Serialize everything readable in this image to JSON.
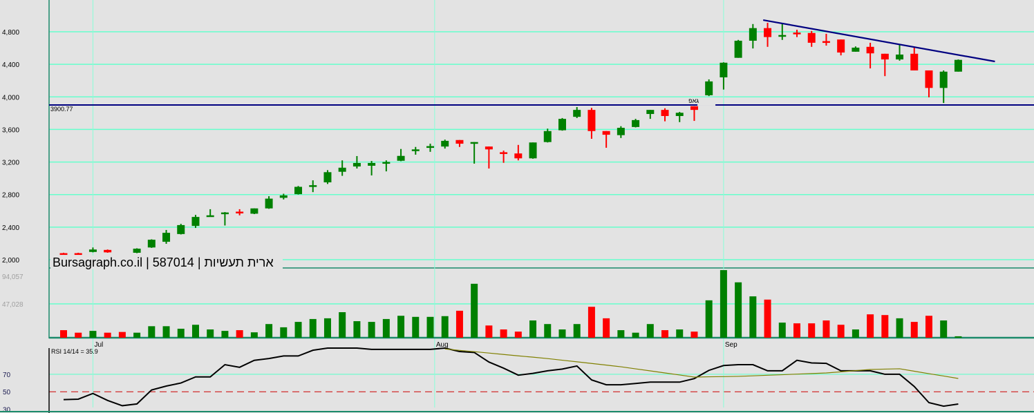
{
  "chart_data": {
    "type": "candlestick",
    "title": "Bursagraph.co.il | 587014 | ארית תעשיות",
    "colors": {
      "up": "#008000",
      "down": "#ff0000",
      "grid": "#66ffcc",
      "trendline": "#000080",
      "rsi": "#000000",
      "rsi_ma": "#808000",
      "background": "#e3e3e3"
    },
    "x_labels": [
      {
        "label": "Jul",
        "index": 2
      },
      {
        "label": "Aug",
        "index": 25.3
      },
      {
        "label": "Sep",
        "index": 45
      }
    ],
    "price_axis": {
      "ticks": [
        2000,
        2400,
        2800,
        3200,
        3600,
        4000,
        4400,
        4800
      ],
      "tick_labels": [
        "2,000",
        "2,400",
        "2,800",
        "3,200",
        "3,600",
        "4,000",
        "4,400",
        "4,800"
      ]
    },
    "candles": [
      [
        2080,
        2085,
        2065,
        2070
      ],
      [
        2080,
        2085,
        2065,
        2070
      ],
      [
        2095,
        2150,
        2090,
        2125
      ],
      [
        2120,
        2125,
        2085,
        2090
      ],
      [
        2010,
        2015,
        1985,
        1990
      ],
      [
        2085,
        2140,
        2080,
        2135
      ],
      [
        2150,
        2250,
        2145,
        2245
      ],
      [
        2220,
        2365,
        2195,
        2330
      ],
      [
        2315,
        2440,
        2310,
        2425
      ],
      [
        2415,
        2550,
        2390,
        2525
      ],
      [
        2535,
        2620,
        2530,
        2545
      ],
      [
        2570,
        2585,
        2420,
        2580
      ],
      [
        2590,
        2620,
        2545,
        2580
      ],
      [
        2565,
        2630,
        2560,
        2630
      ],
      [
        2630,
        2780,
        2625,
        2750
      ],
      [
        2760,
        2810,
        2740,
        2790
      ],
      [
        2805,
        2905,
        2800,
        2895
      ],
      [
        2905,
        2975,
        2830,
        2915
      ],
      [
        2950,
        3100,
        2930,
        3075
      ],
      [
        3080,
        3220,
        3030,
        3130
      ],
      [
        3145,
        3273,
        3120,
        3188
      ],
      [
        3154,
        3213,
        3035,
        3188
      ],
      [
        3195,
        3220,
        3085,
        3200
      ],
      [
        3215,
        3360,
        3210,
        3275
      ],
      [
        3345,
        3385,
        3290,
        3355
      ],
      [
        3390,
        3425,
        3325,
        3395
      ],
      [
        3390,
        3475,
        3365,
        3460
      ],
      [
        3470,
        3470,
        3385,
        3425
      ],
      [
        3440,
        3445,
        3180,
        3445
      ],
      [
        3390,
        3390,
        3120,
        3355
      ],
      [
        3320,
        3340,
        3190,
        3315
      ],
      [
        3305,
        3410,
        3220,
        3245
      ],
      [
        3245,
        3440,
        3240,
        3440
      ],
      [
        3445,
        3610,
        3440,
        3580
      ],
      [
        3590,
        3740,
        3585,
        3730
      ],
      [
        3755,
        3875,
        3740,
        3840
      ],
      [
        3840,
        3865,
        3485,
        3580
      ],
      [
        3580,
        3580,
        3375,
        3535
      ],
      [
        3530,
        3640,
        3495,
        3620
      ],
      [
        3630,
        3730,
        3625,
        3715
      ],
      [
        3790,
        3840,
        3730,
        3840
      ],
      [
        3840,
        3860,
        3700,
        3765
      ],
      [
        3765,
        3815,
        3690,
        3805
      ],
      [
        3885,
        3885,
        3705,
        3840
      ],
      [
        4020,
        4215,
        4010,
        4190
      ],
      [
        4240,
        4425,
        4090,
        4420
      ],
      [
        4480,
        4700,
        4480,
        4690
      ],
      [
        4690,
        4895,
        4595,
        4845
      ],
      [
        4845,
        4910,
        4615,
        4735
      ],
      [
        4755,
        4895,
        4700,
        4760
      ],
      [
        4790,
        4825,
        4735,
        4780
      ],
      [
        4785,
        4810,
        4615,
        4665
      ],
      [
        4685,
        4775,
        4630,
        4680
      ],
      [
        4705,
        4705,
        4510,
        4545
      ],
      [
        4555,
        4620,
        4555,
        4605
      ],
      [
        4615,
        4665,
        4350,
        4535
      ],
      [
        4530,
        4530,
        4255,
        4460
      ],
      [
        4460,
        4640,
        4445,
        4520
      ],
      [
        4530,
        4605,
        4325,
        4325
      ],
      [
        4325,
        4325,
        3995,
        4110
      ],
      [
        4110,
        4325,
        3925,
        4310
      ],
      [
        4310,
        4460,
        4310,
        4455
      ]
    ],
    "candle_fields": [
      "open",
      "high",
      "low",
      "close"
    ],
    "support_line": {
      "value": 3900.77,
      "label": "3900.77"
    },
    "trendline": {
      "start": {
        "index": 47.7,
        "price": 4944
      },
      "end": {
        "index": 63.5,
        "price": 4435
      }
    },
    "gap_annotation": {
      "label": "גאפ",
      "index": 43.5,
      "price": 3900.77
    },
    "volume": {
      "tick_labels": [
        "94,057",
        "47,028"
      ],
      "ticks": [
        94057,
        47028
      ],
      "values": [
        10500,
        7000,
        9500,
        7000,
        8000,
        7000,
        16000,
        16000,
        12500,
        18000,
        11500,
        9500,
        10500,
        7500,
        19000,
        14500,
        22000,
        26000,
        27000,
        35500,
        23000,
        22000,
        26000,
        30500,
        29000,
        29000,
        30000,
        37500,
        75000,
        17000,
        11500,
        8500,
        24000,
        19000,
        11500,
        19000,
        43000,
        27000,
        10500,
        7000,
        19000,
        10500,
        11500,
        8500,
        52000,
        94000,
        77000,
        57500,
        53000,
        21000,
        20000,
        20000,
        24000,
        18000,
        11500,
        32500,
        31500,
        27000,
        22000,
        30500,
        24000,
        2000
      ]
    },
    "rsi": {
      "label": "RSI 14/14 = 35.9",
      "ticks": [
        70,
        50,
        30
      ],
      "tick_labels": [
        "70",
        "50",
        "30"
      ],
      "dashed_level": 50,
      "values": [
        41,
        41.5,
        48,
        40,
        34,
        36,
        52,
        56.5,
        60,
        67,
        67,
        81,
        78,
        86,
        88,
        91,
        91,
        97.5,
        100,
        100,
        100,
        98.5,
        98.5,
        98.5,
        98.5,
        98.5,
        100,
        96,
        95,
        84,
        77,
        69,
        71,
        74,
        76,
        79.5,
        63.5,
        58,
        58,
        59.5,
        61,
        61,
        61,
        65,
        74.5,
        80,
        81,
        81,
        74,
        74,
        86,
        83,
        82.5,
        74,
        74,
        74,
        70,
        70,
        56,
        37.5,
        33.5,
        35.9
      ],
      "ma_values": [
        null,
        null,
        null,
        null,
        null,
        null,
        null,
        null,
        null,
        null,
        null,
        null,
        null,
        null,
        null,
        null,
        null,
        null,
        null,
        null,
        null,
        null,
        null,
        null,
        null,
        null,
        99,
        97.4,
        95.9,
        94.3,
        92.7,
        91.1,
        89.6,
        88,
        86.1,
        84.3,
        82.4,
        80.5,
        78.6,
        76.2,
        73.9,
        71.5,
        69.2,
        66.8,
        67.1,
        67.3,
        67.6,
        68.2,
        68.9,
        69.5,
        70.2,
        70.8,
        71.5,
        72.8,
        74.2,
        75.5,
        75.9,
        76.3,
        73.5,
        70.7,
        68,
        65.2
      ]
    }
  }
}
